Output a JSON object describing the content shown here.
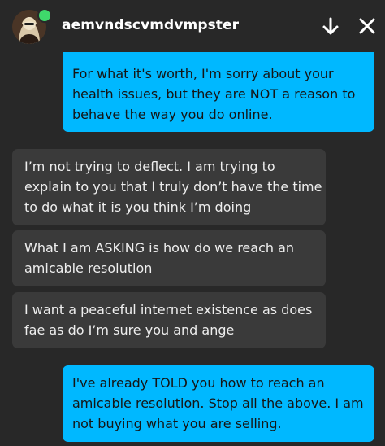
{
  "header": {
    "username": "aemvndscvmdvmpster",
    "status": "online",
    "actions": [
      "arrow-down-icon",
      "close-icon"
    ]
  },
  "colors": {
    "background": "#282828",
    "outgoing_bubble": "#00b8ff",
    "incoming_bubble": "#3a3a3a",
    "online": "#3fd96b"
  },
  "messages": [
    {
      "direction": "outgoing",
      "lines": [
        "For what it's worth, I'm sorry about your",
        "health issues, but they are NOT a reason to",
        "behave the way you do online."
      ]
    },
    {
      "direction": "incoming",
      "lines": [
        "I’m not trying to deflect. I am trying to",
        "explain to you that I truly don’t have the time",
        "to do what it is you think I’m doing"
      ]
    },
    {
      "direction": "incoming",
      "lines": [
        "What I am ASKING is how do we reach an",
        "amicable resolution"
      ]
    },
    {
      "direction": "incoming",
      "lines": [
        "I want a peaceful internet existence as does",
        "fae as do I’m sure you and ange"
      ]
    },
    {
      "direction": "outgoing",
      "lines": [
        "I've already TOLD you how to reach an",
        "amicable resolution. Stop all the above. I am",
        "not buying what you are selling."
      ]
    }
  ]
}
